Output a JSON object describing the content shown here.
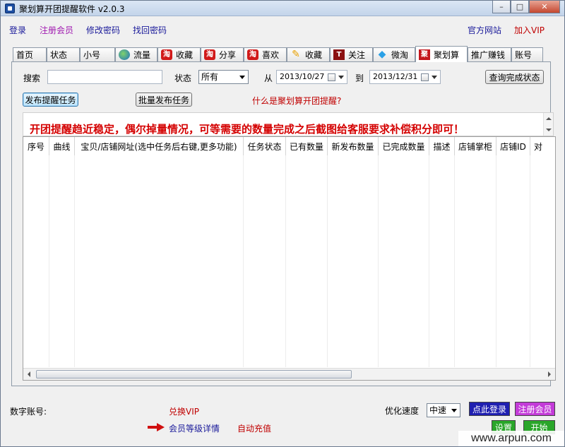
{
  "window": {
    "title": "聚划算开团提醒软件 v2.0.3",
    "controls": {
      "minimize": "–",
      "maximize": "□",
      "close": "✕"
    }
  },
  "toplinks": {
    "login": "登录",
    "register": "注册会员",
    "change_password": "修改密码",
    "recover_password": "找回密码",
    "official_site": "官方网站",
    "join_vip": "加入VIP"
  },
  "tabs": [
    {
      "label": "首页",
      "icon": ""
    },
    {
      "label": "状态",
      "icon": ""
    },
    {
      "label": "小号",
      "icon": ""
    },
    {
      "label": "流量",
      "icon": "globe-icon"
    },
    {
      "label": "收藏",
      "icon": "taobao-icon"
    },
    {
      "label": "分享",
      "icon": "taobao-icon"
    },
    {
      "label": "喜欢",
      "icon": "taobao-icon"
    },
    {
      "label": "收藏",
      "icon": "feather-icon"
    },
    {
      "label": "关注",
      "icon": "tmall-icon"
    },
    {
      "label": "微淘",
      "icon": "diamond-icon"
    },
    {
      "label": "聚划算",
      "icon": "ju-icon",
      "active": true
    },
    {
      "label": "推广赚钱",
      "icon": ""
    },
    {
      "label": "账号",
      "icon": ""
    }
  ],
  "tab_icon_glyphs": {
    "taobao": "淘",
    "tmall": "T",
    "ju": "聚",
    "diamond": "◆",
    "feather": "✎"
  },
  "search": {
    "label": "搜索",
    "value": "",
    "status_label": "状态",
    "status_value": "所有",
    "from_label": "从",
    "from_date": "2013/10/27",
    "to_label": "到",
    "to_date": "2013/12/31",
    "query_button": "查询完成状态"
  },
  "actions": {
    "publish": "发布提醒任务",
    "batch_publish": "批量发布任务",
    "what_is": "什么是聚划算开团提醒?"
  },
  "notice": "开团提醒趋近稳定，偶尔掉量情况，可等需要的数量完成之后截图给客服要求补偿积分即可！",
  "table": {
    "columns": [
      "序号",
      "曲线",
      "宝贝/店铺网址(选中任务后右键,更多功能)",
      "任务状态",
      "已有数量",
      "新发布数量",
      "已完成数量",
      "描述",
      "店铺掌柜",
      "店铺ID",
      "对"
    ],
    "rows": []
  },
  "bottom": {
    "digital_account_label": "数字账号:",
    "exchange_vip": "兑换VIP",
    "member_level": "会员等级详情",
    "auto_recharge": "自动充值",
    "speed_label": "优化速度",
    "speed_value": "中速",
    "login_here": "点此登录",
    "register_member": "注册会员",
    "settings": "设置",
    "start": "开始"
  },
  "watermark": "www.arpun.com",
  "colors": {
    "notice_red": "#d40000",
    "link_blue": "#1a1a9a",
    "link_purple": "#a01ab0",
    "btn_blue": "#1f1fb0",
    "btn_magenta": "#c33bd8",
    "btn_green": "#2aa62a"
  }
}
